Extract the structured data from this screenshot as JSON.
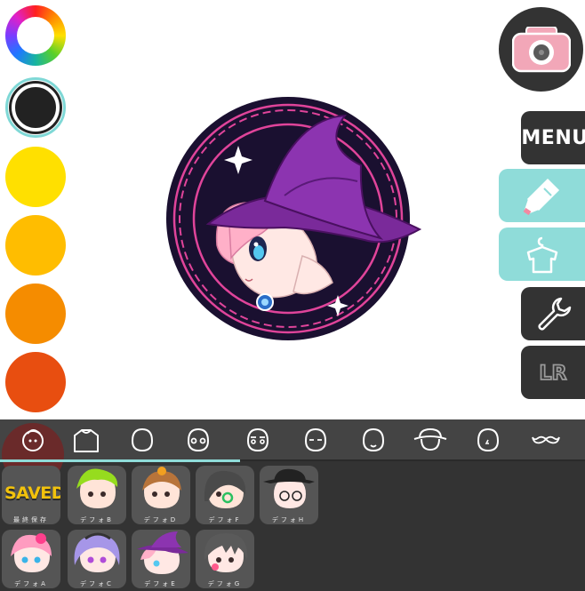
{
  "palette": {
    "colors": [
      "#ffe000",
      "#ffbd00",
      "#f58c00",
      "#e84e10"
    ],
    "selected_color": "#222222"
  },
  "canvas": {
    "emblem_border": "#1a1030",
    "emblem_accent": "#e0449a"
  },
  "right_panel": {
    "menu_label": "MENU",
    "swap_label": "LR"
  },
  "categories": [
    {
      "icon": "face-outline-icon"
    },
    {
      "icon": "shirt-icon"
    },
    {
      "icon": "head-icon"
    },
    {
      "icon": "head-eyes-icon"
    },
    {
      "icon": "head-brows-icon"
    },
    {
      "icon": "head-closed-eyes-icon"
    },
    {
      "icon": "head-mouth-icon"
    },
    {
      "icon": "hat-icon"
    },
    {
      "icon": "head-nose-icon"
    },
    {
      "icon": "mustache-icon"
    }
  ],
  "presets": [
    {
      "label": "最終保存",
      "badge": "SAVED"
    },
    {
      "label": "デフォB"
    },
    {
      "label": "デフォD"
    },
    {
      "label": "デフォF"
    },
    {
      "label": "デフォH"
    },
    {
      "label": "デフォA"
    },
    {
      "label": "デフォC"
    },
    {
      "label": "デフォE"
    },
    {
      "label": "デフォG"
    }
  ]
}
